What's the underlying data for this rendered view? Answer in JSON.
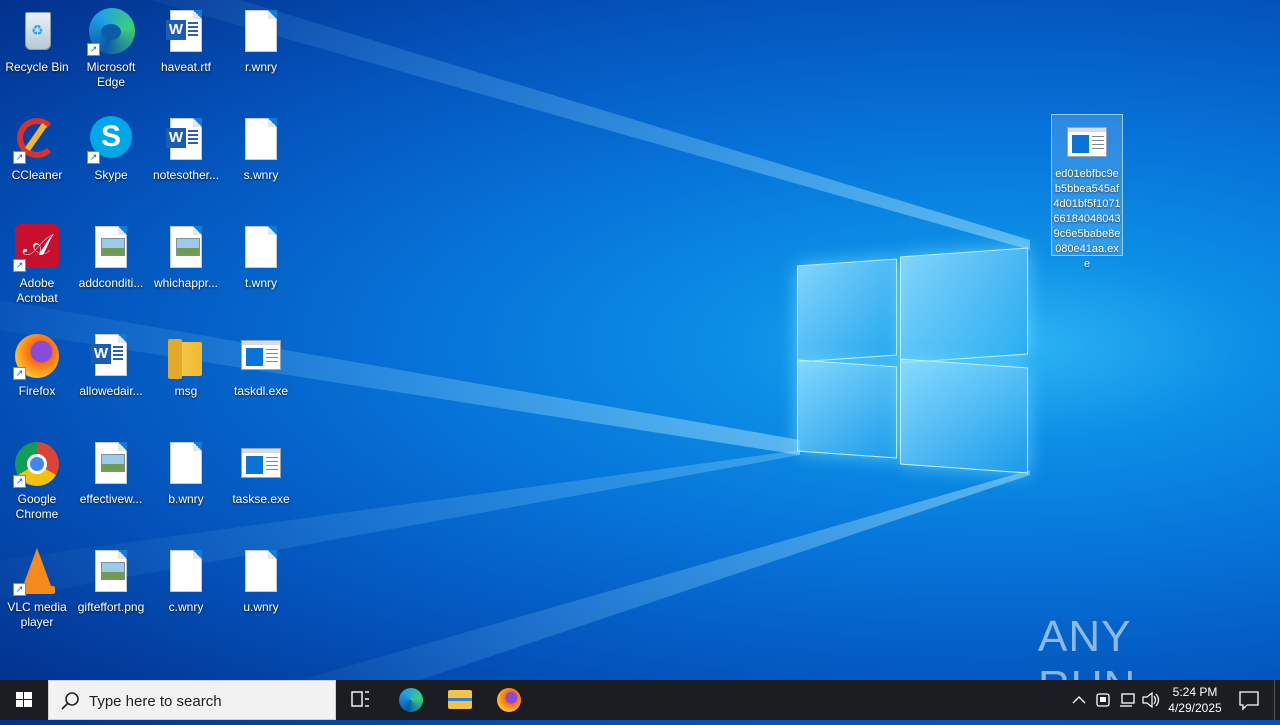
{
  "desktop": {
    "icons": [
      {
        "label": "Recycle Bin"
      },
      {
        "label": "Microsoft Edge"
      },
      {
        "label": "haveat.rtf"
      },
      {
        "label": "r.wnry"
      },
      {
        "label": "CCleaner"
      },
      {
        "label": "Skype"
      },
      {
        "label": "notesother..."
      },
      {
        "label": "s.wnry"
      },
      {
        "label": "Adobe Acrobat"
      },
      {
        "label": "addconditi..."
      },
      {
        "label": "whichappr..."
      },
      {
        "label": "t.wnry"
      },
      {
        "label": "Firefox"
      },
      {
        "label": "allowedair..."
      },
      {
        "label": "msg"
      },
      {
        "label": "taskdl.exe"
      },
      {
        "label": "Google Chrome"
      },
      {
        "label": "effectivew..."
      },
      {
        "label": "b.wnry"
      },
      {
        "label": "taskse.exe"
      },
      {
        "label": "VLC media player"
      },
      {
        "label": "gifteffort.png"
      },
      {
        "label": "c.wnry"
      },
      {
        "label": "u.wnry"
      }
    ],
    "selected_file": {
      "label": "ed01ebfbc9eb5bbea545af4d01bf5f107166184048043 9c6e5babe8e080e41aa.exe"
    }
  },
  "watermark": {
    "text": "ANY RUN"
  },
  "taskbar": {
    "search_placeholder": "Type here to search",
    "clock_time": "5:24 PM",
    "clock_date": "4/29/2025"
  },
  "colors": {
    "taskbar": "#1b1d22",
    "selection": "#96c8ff",
    "accent": "#0a74d6"
  }
}
